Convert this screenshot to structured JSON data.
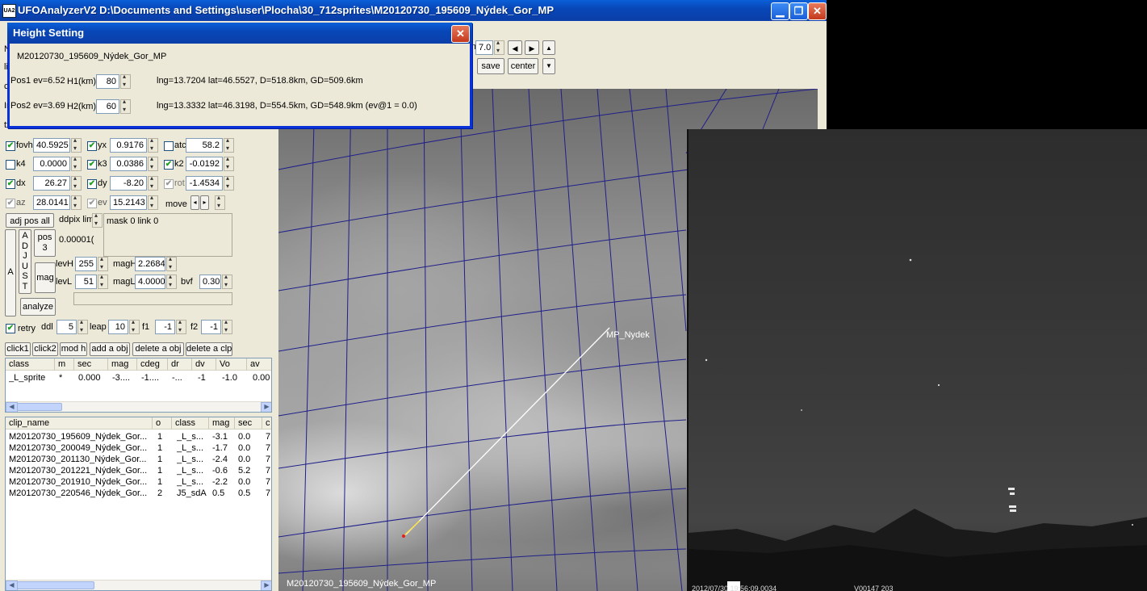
{
  "window": {
    "title": "UFOAnalyzerV2 D:\\Documents and Settings\\user\\Plocha\\30_712sprites\\M20120730_195609_Nýdek_Gor_MP",
    "icon_text": "UA2",
    "min_glyph": "▁",
    "max_glyph": "❐",
    "close_glyph": "✕"
  },
  "toolbar": {
    "value": "7.0",
    "save_label": "save",
    "center_label": "center",
    "left_arrow": "◀",
    "right_arrow": "▶",
    "up_arrow": "▲",
    "down_arrow": "▼",
    "partial_m": "m"
  },
  "left_edge_letters": [
    "N",
    "li",
    "c",
    "In",
    "tx"
  ],
  "height_dialog": {
    "title": "Height Setting",
    "close_glyph": "✕",
    "clip_name": "M20120730_195609_Nýdek_Gor_MP",
    "pos1": {
      "label": "Pos1 ev=6.52",
      "h_label": "H1(km)",
      "h_value": "80",
      "info": "lng=13.7204 lat=46.5527, D=518.8km, GD=509.6km"
    },
    "pos2": {
      "label": "Pos2 ev=3.69",
      "h_label": "H2(km)",
      "h_value": "60",
      "info": "lng=13.3332 lat=46.3198, D=554.5km, GD=548.9km  (ev@1 = 0.0)"
    }
  },
  "params": {
    "row1": [
      {
        "checked": true,
        "label": "fovh",
        "value": "40.5925"
      },
      {
        "checked": true,
        "label": "yx",
        "value": "0.9176"
      },
      {
        "checked": false,
        "label": "atc",
        "value": "58.2"
      }
    ],
    "row2": [
      {
        "checked": false,
        "label": "k4",
        "value": "0.0000"
      },
      {
        "checked": true,
        "label": "k3",
        "value": "0.0386"
      },
      {
        "checked": true,
        "label": "k2",
        "value": "-0.0192"
      }
    ],
    "row3": [
      {
        "checked": true,
        "label": "dx",
        "value": "26.27"
      },
      {
        "checked": true,
        "label": "dy",
        "value": "-8.20"
      },
      {
        "checked": true,
        "label": "rot",
        "value": "-1.4534",
        "gray": true
      }
    ],
    "row4": [
      {
        "checked": true,
        "label": "az",
        "value": "28.0141",
        "gray": true
      },
      {
        "checked": true,
        "label": "ev",
        "value": "15.2143",
        "gray": true
      }
    ],
    "move_label": "move"
  },
  "adjust": {
    "adj_pos_all": "adj pos all",
    "ddpix_label": "ddpix lim",
    "ddpix_value": "0.00001(",
    "mask_link": "mask 0  link 0",
    "a_label": "A",
    "adjust_vertical": [
      "A",
      "D",
      "J",
      "U",
      "S",
      "T"
    ],
    "pos3": "pos\n3",
    "mag_btn": "mag",
    "analyze": "analyze",
    "levH_label": "levH",
    "levH": "255",
    "levL_label": "levL",
    "levL": "51",
    "magH_label": "magH",
    "magH": "2.2684",
    "magL_label": "magL",
    "magL": "4.0000",
    "bvf_label": "bvf",
    "bvf": "0.30"
  },
  "retry_row": {
    "retry_label": "retry",
    "retry_checked": true,
    "ddl_label": "ddl",
    "ddl": "5",
    "leap_label": "leap",
    "leap": "10",
    "f1_label": "f1",
    "f1": "-1",
    "f2_label": "f2",
    "f2": "-1"
  },
  "actions": [
    "click1",
    "click2",
    "mod h",
    "add a obj",
    "delete a obj",
    "delete a clp"
  ],
  "obj_table": {
    "columns": [
      "class",
      "m",
      "sec",
      "mag",
      "cdeg",
      "dr",
      "dv",
      "Vo",
      "av"
    ],
    "rows": [
      [
        "_L_sprite",
        "*",
        "0.000",
        "-3....",
        "-1....",
        "-...",
        "-1",
        "-1.0",
        "0.00"
      ]
    ]
  },
  "clip_table": {
    "columns": [
      "clip_name",
      "o",
      "class",
      "mag",
      "sec",
      "c"
    ],
    "rows": [
      [
        "M20120730_195609_Nýdek_Gor...",
        "1",
        "_L_s...",
        "-3.1",
        "0.0",
        "7"
      ],
      [
        "M20120730_200049_Nýdek_Gor...",
        "1",
        "_L_s...",
        "-1.7",
        "0.0",
        "7"
      ],
      [
        "M20120730_201130_Nýdek_Gor...",
        "1",
        "_L_s...",
        "-2.4",
        "0.0",
        "7"
      ],
      [
        "M20120730_201221_Nýdek_Gor...",
        "1",
        "_L_s...",
        "-0.6",
        "5.2",
        "7"
      ],
      [
        "M20120730_201910_Nýdek_Gor...",
        "1",
        "_L_s...",
        "-2.2",
        "0.0",
        "7"
      ],
      [
        "M20120730_220546_Nýdek_Gor...",
        "2",
        "J5_sdA",
        "0.5",
        "0.5",
        "7"
      ]
    ]
  },
  "map": {
    "station_label": "MP_Nydek",
    "bottom_label": "M20120730_195609_Nýdek_Gor_MP"
  },
  "camera": {
    "timestamp": "2012/07/30 19:56:09.0034",
    "frame_code": "V00147 203"
  }
}
